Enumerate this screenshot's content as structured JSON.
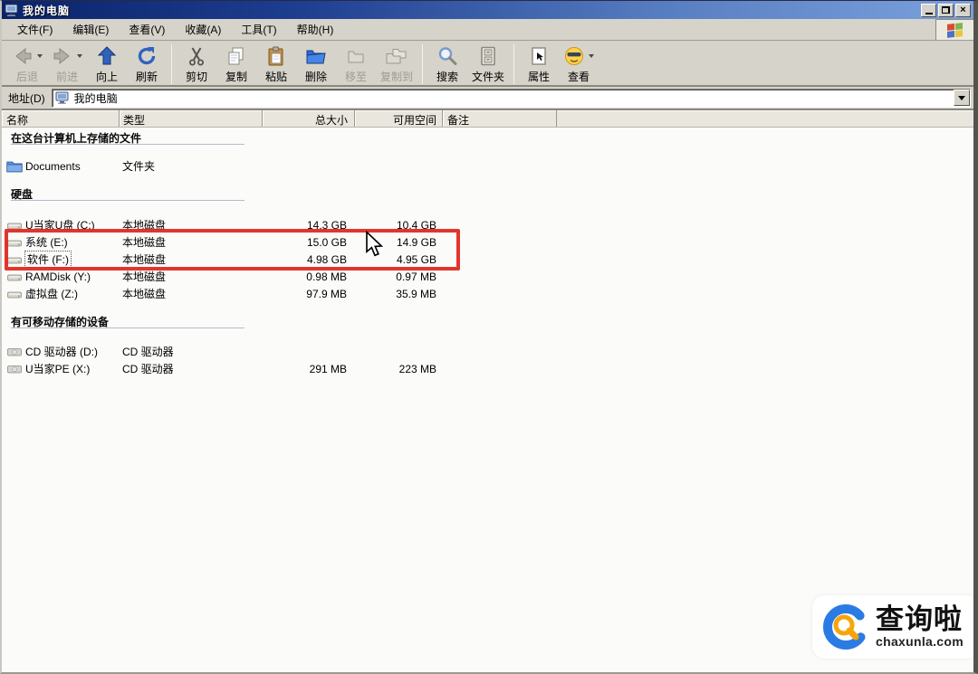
{
  "window": {
    "title": "我的电脑"
  },
  "menubar": {
    "items": [
      "文件(F)",
      "编辑(E)",
      "查看(V)",
      "收藏(A)",
      "工具(T)",
      "帮助(H)"
    ]
  },
  "toolbar": {
    "buttons": [
      {
        "label": "后退",
        "icon": "back-arrow",
        "disabled": true,
        "dropdown": true
      },
      {
        "label": "前进",
        "icon": "forward-arrow",
        "disabled": true,
        "dropdown": true
      },
      {
        "label": "向上",
        "icon": "up-arrow",
        "disabled": false
      },
      {
        "label": "刷新",
        "icon": "refresh",
        "disabled": false
      },
      {
        "label": "剪切",
        "icon": "scissors",
        "disabled": false
      },
      {
        "label": "复制",
        "icon": "copy-pages",
        "disabled": false
      },
      {
        "label": "粘贴",
        "icon": "clipboard",
        "disabled": false
      },
      {
        "label": "删除",
        "icon": "blue-folder",
        "disabled": false
      },
      {
        "label": "移至",
        "icon": "move-folder",
        "disabled": true
      },
      {
        "label": "复制到",
        "icon": "copyto-folders",
        "disabled": true
      },
      {
        "label": "搜索",
        "icon": "magnifier",
        "disabled": false
      },
      {
        "label": "文件夹",
        "icon": "folders-pane",
        "disabled": false
      },
      {
        "label": "属性",
        "icon": "properties",
        "disabled": false
      },
      {
        "label": "查看",
        "icon": "views-smiley",
        "disabled": false,
        "dropdown": true
      }
    ]
  },
  "addressbar": {
    "label": "地址(D)",
    "value": "我的电脑"
  },
  "columns": [
    "名称",
    "类型",
    "总大小",
    "可用空间",
    "备注"
  ],
  "groups": [
    {
      "title": "在这台计算机上存储的文件",
      "rows": [
        {
          "name": "Documents",
          "type": "文件夹",
          "size": "",
          "free": ""
        }
      ]
    },
    {
      "title": "硬盘",
      "rows": [
        {
          "name": "U当家U盘 (C:)",
          "type": "本地磁盘",
          "size": "14.3 GB",
          "free": "10.4 GB"
        },
        {
          "name": "系统 (E:)",
          "type": "本地磁盘",
          "size": "15.0 GB",
          "free": "14.9 GB"
        },
        {
          "name": "软件 (F:)",
          "type": "本地磁盘",
          "size": "4.98 GB",
          "free": "4.95 GB"
        },
        {
          "name": "RAMDisk (Y:)",
          "type": "本地磁盘",
          "size": "0.98 MB",
          "free": "0.97 MB"
        },
        {
          "name": "虚拟盘 (Z:)",
          "type": "本地磁盘",
          "size": "97.9 MB",
          "free": "35.9 MB"
        }
      ]
    },
    {
      "title": "有可移动存储的设备",
      "rows": [
        {
          "name": "CD 驱动器 (D:)",
          "type": "CD 驱动器",
          "size": "",
          "free": ""
        },
        {
          "name": "U当家PE (X:)",
          "type": "CD 驱动器",
          "size": "291 MB",
          "free": "223 MB"
        }
      ]
    }
  ],
  "annotation": {
    "shape": "red-rectangle",
    "color": "#df241b",
    "highlights": [
      "系统 (E:)",
      "软件 (F:)"
    ]
  },
  "watermark": {
    "title": "查询啦",
    "domain": "chaxunla.com",
    "blue": "#2b7be4",
    "orange": "#f7a50c"
  },
  "colors": {
    "titlebar_start": "#0a246a",
    "titlebar_end": "#7ba0dc",
    "chrome_gray": "#d6d3ca"
  }
}
